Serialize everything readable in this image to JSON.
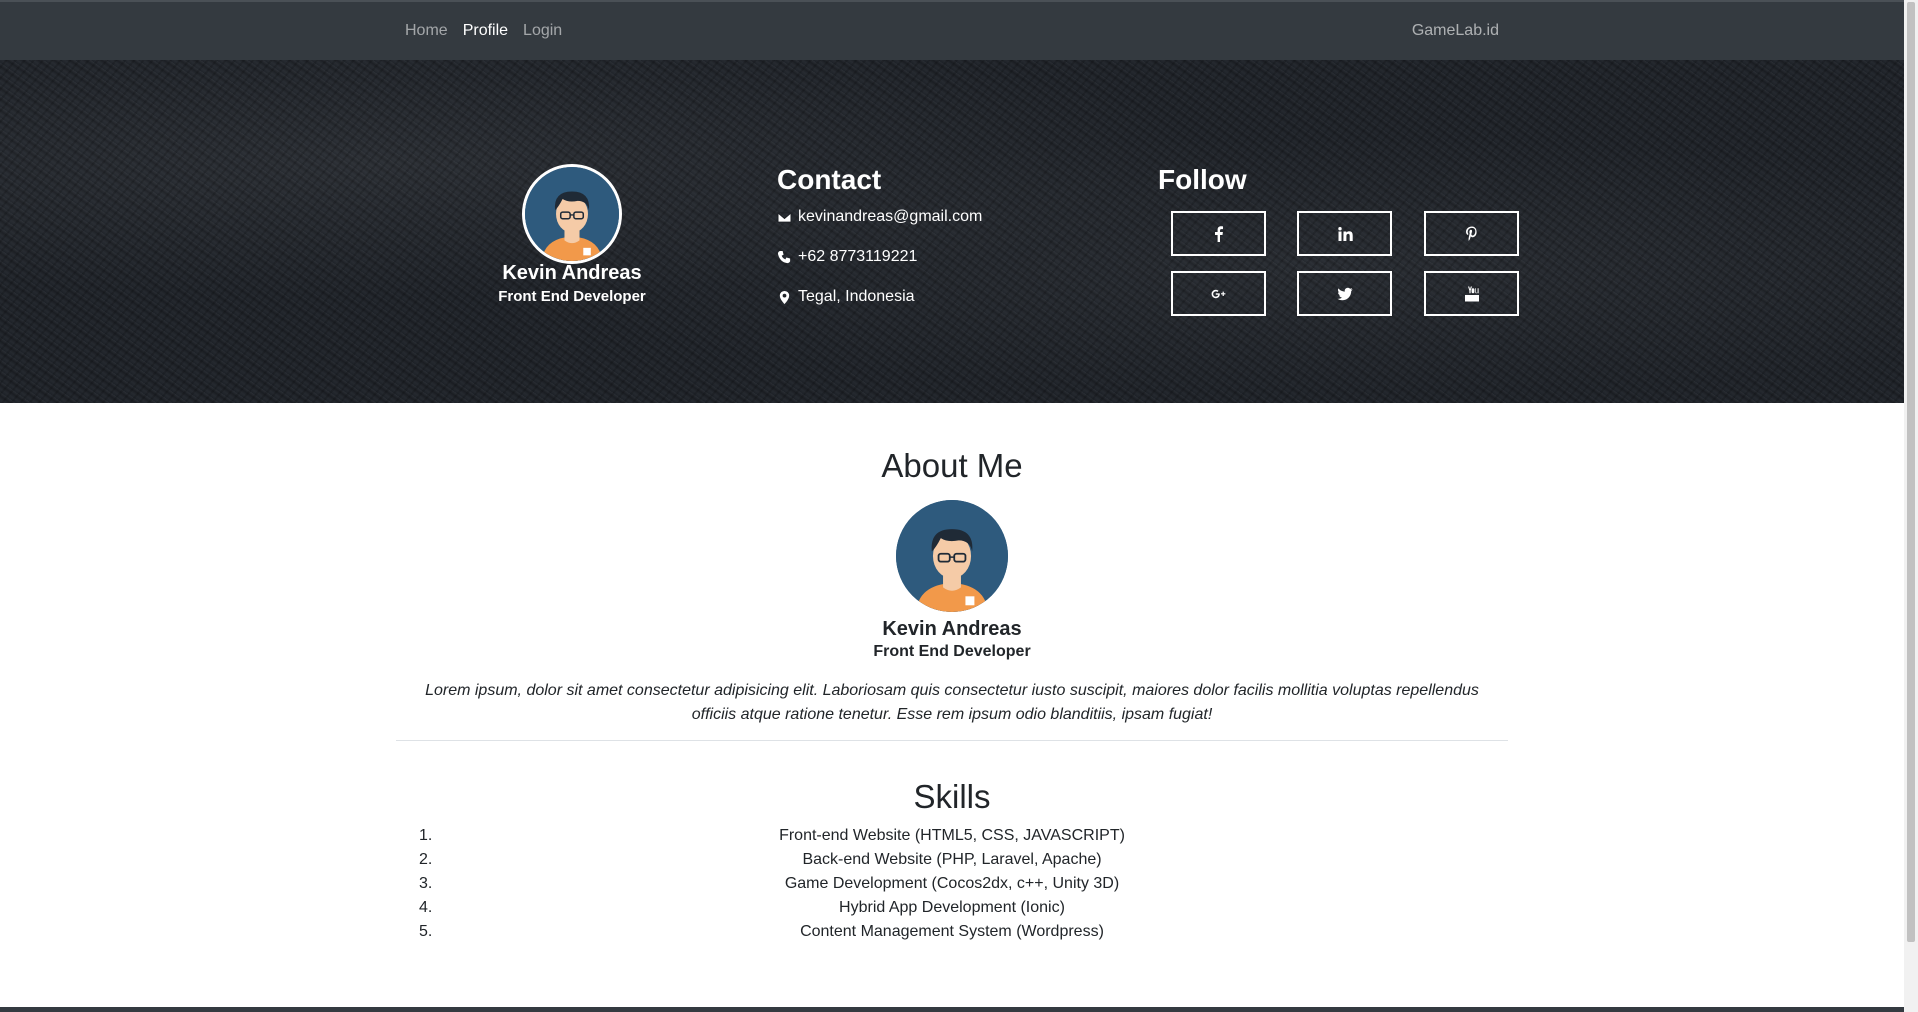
{
  "nav": {
    "links": [
      "Home",
      "Profile",
      "Login"
    ],
    "active": "Profile",
    "brand": "GameLab.id"
  },
  "hero": {
    "name": "Kevin Andreas",
    "role": "Front End Developer",
    "contact": {
      "title": "Contact",
      "email": "kevinandreas@gmail.com",
      "phone": "+62 8773119221",
      "location": "Tegal, Indonesia"
    },
    "follow": {
      "title": "Follow",
      "icons": [
        "facebook-icon",
        "linkedin-icon",
        "pinterest-icon",
        "google-plus-icon",
        "twitter-icon",
        "youtube-icon"
      ]
    }
  },
  "about": {
    "title": "About Me",
    "name": "Kevin Andreas",
    "role": "Front End Developer",
    "text": "Lorem ipsum, dolor sit amet consectetur adipisicing elit. Laboriosam quis consectetur iusto suscipit, maiores dolor facilis mollitia voluptas repellendus officiis atque ratione tenetur. Esse rem ipsum odio blanditiis, ipsam fugiat!"
  },
  "skills": {
    "title": "Skills",
    "items": [
      {
        "num": "1.",
        "label": "Front-end Website (HTML5, CSS, JAVASCRIPT)"
      },
      {
        "num": "2.",
        "label": "Back-end Website (PHP, Laravel, Apache)"
      },
      {
        "num": "3.",
        "label": "Game Development (Cocos2dx, c++, Unity 3D)"
      },
      {
        "num": "4.",
        "label": "Hybrid App Development (Ionic)"
      },
      {
        "num": "5.",
        "label": "Content Management System (Wordpress)"
      }
    ]
  },
  "colors": {
    "navbar": "#343a40",
    "avatar_bg": "#2e5a7d",
    "text": "#212529"
  }
}
